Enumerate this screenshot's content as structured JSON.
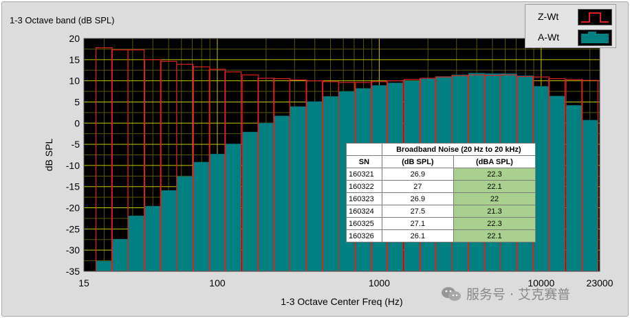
{
  "chart_data": {
    "type": "bar",
    "title": "1-3 Octave band (dB SPL)",
    "xlabel": "1-3 Octave Center Freq (Hz)",
    "ylabel": "dB SPL",
    "x_scale": "log",
    "xlim": [
      15,
      23000
    ],
    "ylim": [
      -35,
      20
    ],
    "yticks": [
      "20",
      "15",
      "10",
      "5",
      "0",
      "-5",
      "-10",
      "-15",
      "-20",
      "-25",
      "-30",
      "-35"
    ],
    "xticks": [
      "15",
      "100",
      "1000",
      "10000",
      "23000"
    ],
    "grid": true,
    "legend_position": "top-right",
    "center_frequencies": [
      20,
      25,
      31.5,
      40,
      50,
      63,
      80,
      100,
      125,
      160,
      200,
      250,
      315,
      400,
      500,
      630,
      800,
      1000,
      1250,
      1600,
      2000,
      2500,
      3150,
      4000,
      5000,
      6300,
      8000,
      10000,
      12500,
      16000,
      20000
    ],
    "series": [
      {
        "name": "Z-Wt",
        "style": "outline",
        "color": "#e02020",
        "values": [
          17.8,
          17.3,
          17.3,
          15.0,
          14.6,
          13.9,
          13.3,
          12.7,
          12.1,
          11.4,
          10.6,
          10.5,
          10.2,
          10.0,
          9.8,
          9.6,
          9.6,
          9.8,
          10.0,
          10.3,
          10.6,
          10.9,
          11.2,
          11.4,
          11.3,
          11.4,
          11.0,
          10.9,
          10.5,
          10.3,
          10.1
        ]
      },
      {
        "name": "A-Wt",
        "style": "filled",
        "color": "#008080",
        "values": [
          -32.6,
          -27.4,
          -21.9,
          -19.6,
          -15.9,
          -12.6,
          -9.2,
          -7.3,
          -4.9,
          -2.1,
          0.0,
          1.7,
          3.9,
          5.1,
          6.3,
          7.5,
          8.2,
          8.9,
          9.5,
          10.0,
          10.5,
          11.0,
          11.4,
          11.8,
          11.7,
          11.7,
          11.2,
          8.7,
          6.4,
          4.2,
          0.7
        ]
      }
    ],
    "colors": {
      "plot_background": "#000000",
      "grid_major": "#c8c800",
      "grid_minor": "#5a5a00"
    }
  },
  "legend": [
    {
      "label": "Z-Wt",
      "icon": "red-outline-bar-icon"
    },
    {
      "label": "A-Wt",
      "icon": "teal-filled-bar-icon"
    }
  ],
  "table": {
    "title": "Broadband Noise (20 Hz to 20 kHz)",
    "columns": [
      "SN",
      "(dB SPL)",
      "(dBA SPL)"
    ],
    "rows": [
      [
        "160321",
        "26.9",
        "22.3"
      ],
      [
        "160322",
        "27",
        "22.1"
      ],
      [
        "160323",
        "26.9",
        "22"
      ],
      [
        "160324",
        "27.5",
        "21.3"
      ],
      [
        "160325",
        "27.1",
        "22.3"
      ],
      [
        "160326",
        "26.1",
        "22.1"
      ]
    ],
    "highlight_color": "#a9d08e"
  },
  "watermark": {
    "text": "服务号 · 艾克赛普",
    "icon": "wechat-icon"
  }
}
